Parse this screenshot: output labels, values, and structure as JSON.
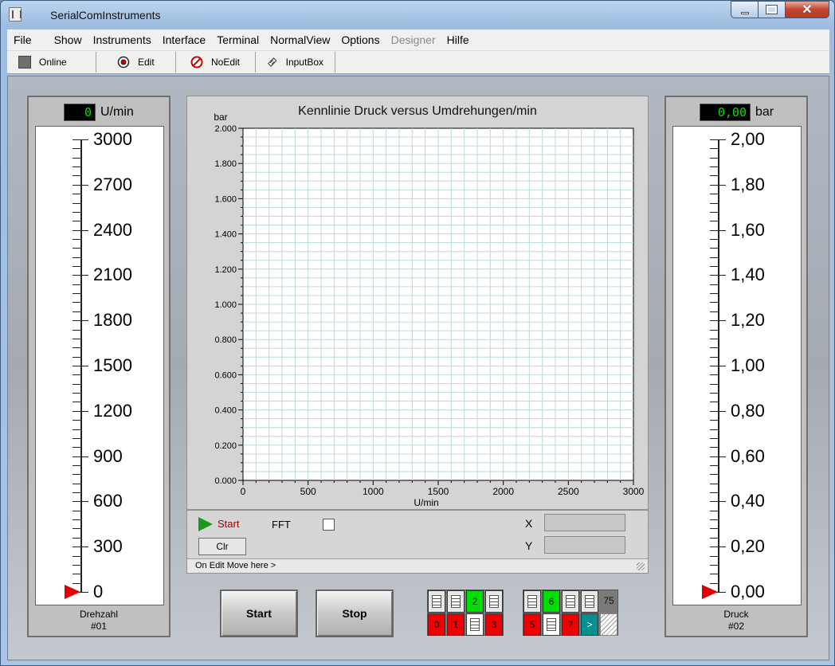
{
  "window": {
    "title": "SerialComInstruments"
  },
  "menu": [
    "File",
    "Show",
    "Instruments",
    "Interface",
    "Terminal",
    "NormalView",
    "Options",
    "Designer",
    "Hilfe"
  ],
  "toolbar": {
    "online": "Online",
    "edit": "Edit",
    "noedit": "NoEdit",
    "inputbox": "InputBox"
  },
  "gauge_left": {
    "readout": "0",
    "unit": "U/min",
    "labels": [
      "3000",
      "2700",
      "2400",
      "2100",
      "1800",
      "1500",
      "1200",
      "900",
      "600",
      "300",
      "0"
    ],
    "value": 0,
    "max": 3000,
    "name": "Drehzahl",
    "id": "#01"
  },
  "gauge_right": {
    "readout": "0,00",
    "unit": "bar",
    "labels": [
      "2,00",
      "1,80",
      "1,60",
      "1,40",
      "1,20",
      "1,00",
      "0,80",
      "0,60",
      "0,40",
      "0,20",
      "0,00"
    ],
    "value": 0,
    "max": 2,
    "name": "Druck",
    "id": "#02"
  },
  "chart_data": {
    "type": "line",
    "title": "Kennlinie  Druck versus Umdrehungen/min",
    "xlabel": "U/min",
    "ylabel": "bar",
    "xlim": [
      0,
      3000
    ],
    "ylim": [
      0,
      2
    ],
    "xticks": [
      "0",
      "500",
      "1000",
      "1500",
      "2000",
      "2500",
      "3000"
    ],
    "yticks": [
      "0.000",
      "0.200",
      "0.400",
      "0.600",
      "0.800",
      "1.000",
      "1.200",
      "1.400",
      "1.600",
      "1.800",
      "2.000"
    ],
    "grid": true,
    "series": []
  },
  "chart_controls": {
    "start": "Start",
    "fft": "FFT",
    "fft_checked": false,
    "clr": "Clr",
    "x_label": "X",
    "y_label": "Y",
    "move_hint": "On Edit Move here >"
  },
  "buttons": {
    "start": "Start",
    "stop": "Stop"
  },
  "io": {
    "group1": {
      "bottom": [
        "0",
        "1",
        "",
        "3"
      ],
      "top_highlight": "2"
    },
    "group2": {
      "bottom": [
        "5",
        "",
        "7",
        ">"
      ],
      "top_highlight": "6",
      "count": "75"
    }
  }
}
